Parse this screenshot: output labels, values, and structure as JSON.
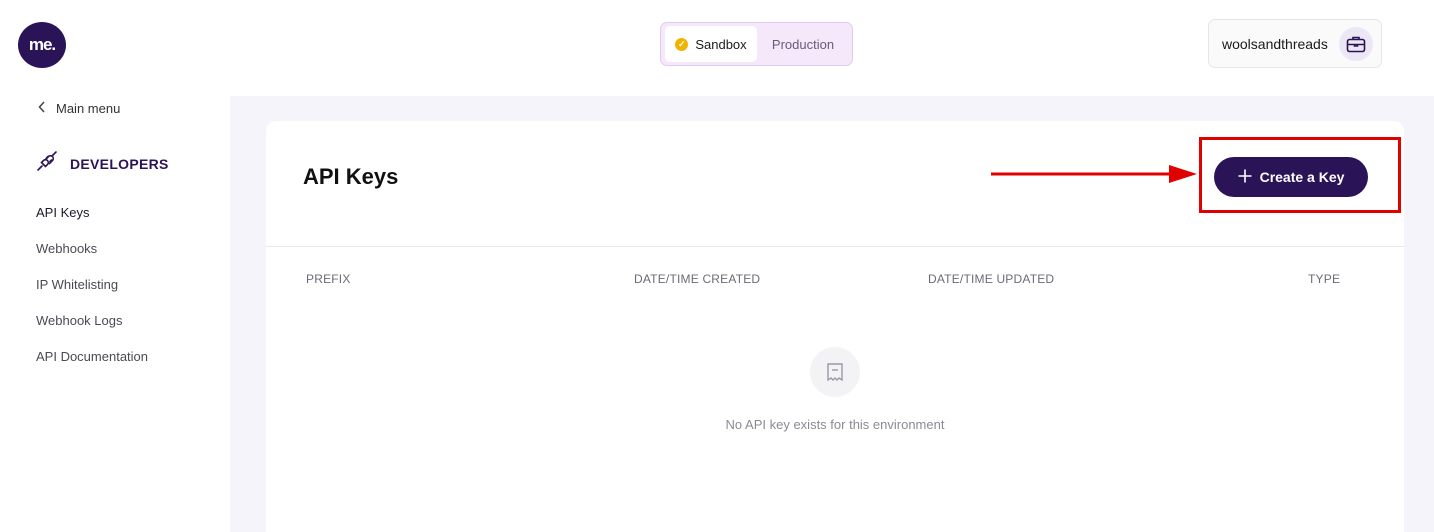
{
  "logo": {
    "text": "me."
  },
  "environment": {
    "options": [
      {
        "label": "Sandbox",
        "active": true
      },
      {
        "label": "Production",
        "active": false
      }
    ]
  },
  "account": {
    "name": "woolsandthreads",
    "icon": "briefcase-icon"
  },
  "sidebar": {
    "back_label": "Main menu",
    "section_title": "DEVELOPERS",
    "section_icon": "plug-icon",
    "items": [
      {
        "label": "API Keys",
        "active": true
      },
      {
        "label": "Webhooks",
        "active": false
      },
      {
        "label": "IP Whitelisting",
        "active": false
      },
      {
        "label": "Webhook Logs",
        "active": false
      },
      {
        "label": "API Documentation",
        "active": false
      }
    ]
  },
  "main": {
    "title": "API Keys",
    "create_button_label": "Create a Key",
    "table": {
      "columns": [
        "PREFIX",
        "DATE/TIME CREATED",
        "DATE/TIME UPDATED",
        "TYPE"
      ],
      "rows": []
    },
    "empty_state": {
      "text": "No API key exists for this environment",
      "icon": "receipt-icon"
    }
  },
  "colors": {
    "brand": "#2a1457",
    "annotation": "#e00000",
    "sandbox_check": "#f0b400"
  }
}
